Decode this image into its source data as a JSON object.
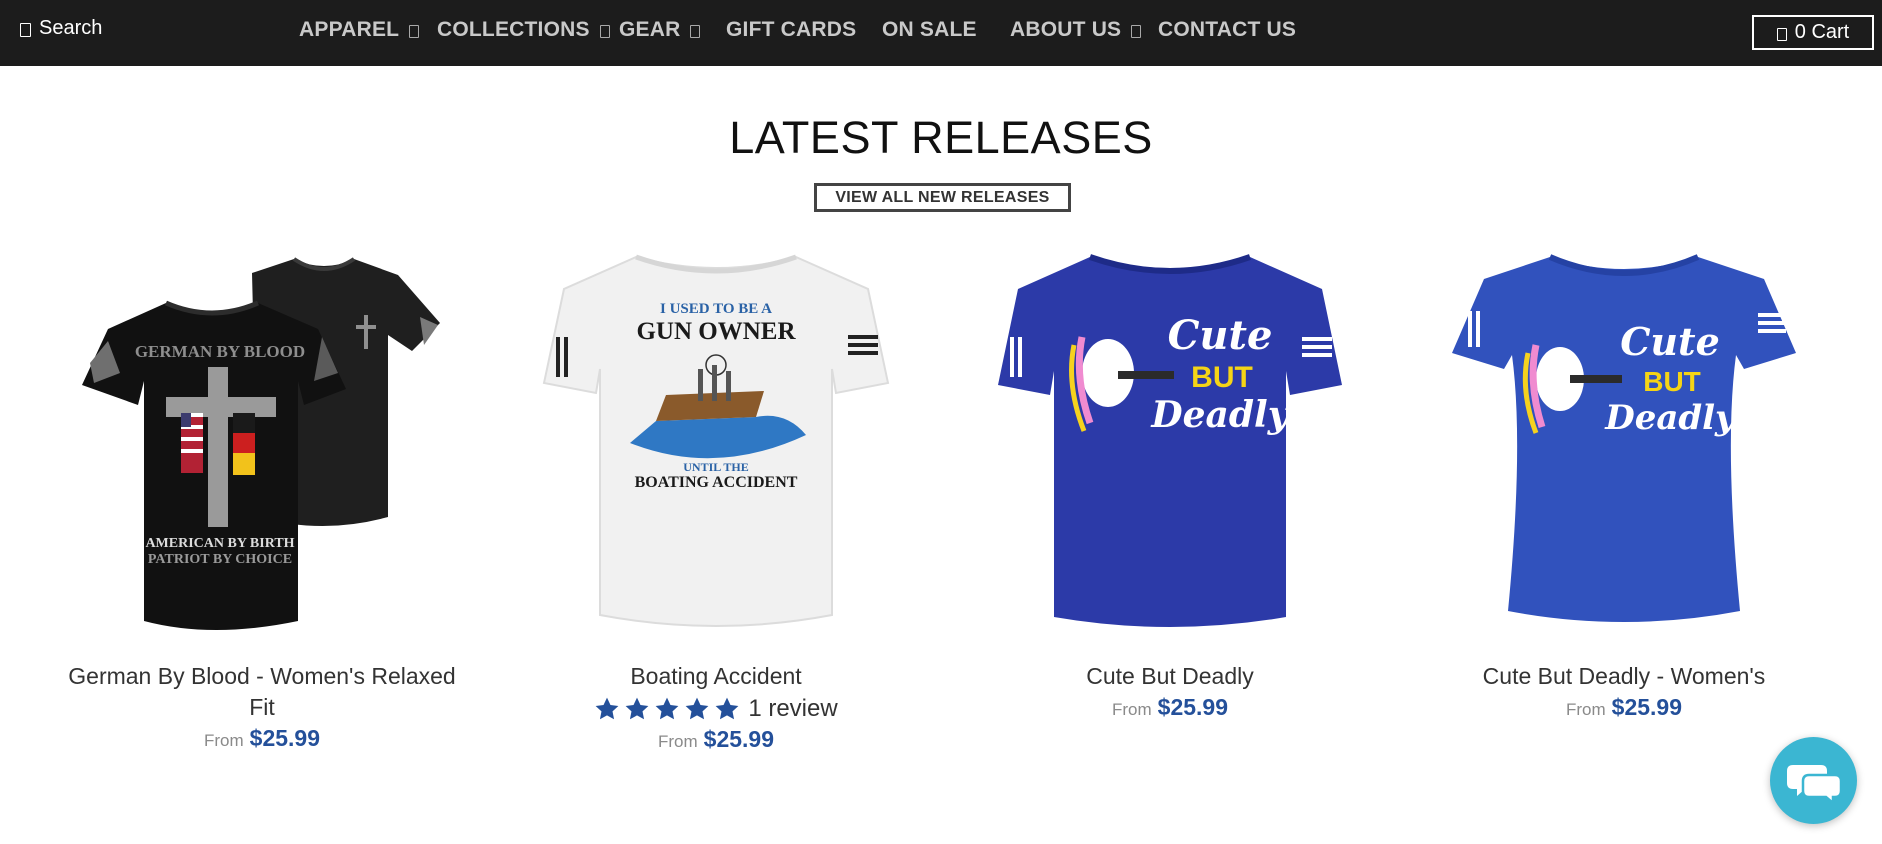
{
  "header": {
    "search_label": "Search",
    "nav": [
      {
        "label": "APPAREL",
        "has_dropdown": true
      },
      {
        "label": "COLLECTIONS",
        "has_dropdown": true
      },
      {
        "label": "GEAR",
        "has_dropdown": true
      },
      {
        "label": "GIFT CARDS",
        "has_dropdown": false
      },
      {
        "label": "ON SALE",
        "has_dropdown": false
      },
      {
        "label": "ABOUT US",
        "has_dropdown": true
      },
      {
        "label": "CONTACT US",
        "has_dropdown": false
      }
    ],
    "cart_label": "0 Cart"
  },
  "section": {
    "title": "LATEST RELEASES",
    "view_all_label": "VIEW ALL NEW RELEASES"
  },
  "products": [
    {
      "title": "German By Blood - Women's Relaxed Fit",
      "price_prefix": "From",
      "price": "$25.99",
      "image_icon": "black-tshirt-cross-flag-print",
      "image_print": [
        "GERMAN BY BLOOD",
        "AMERICAN BY BIRTH",
        "PATRIOT BY CHOICE"
      ]
    },
    {
      "title": "Boating Accident",
      "rating_stars": 5,
      "review_label": "1 review",
      "price_prefix": "From",
      "price": "$25.99",
      "image_icon": "white-tshirt-boat-print",
      "image_print": [
        "I USED TO BE A",
        "GUN OWNER",
        "UNTIL THE",
        "BOATING ACCIDENT"
      ]
    },
    {
      "title": "Cute But Deadly",
      "price_prefix": "From",
      "price": "$25.99",
      "image_icon": "royal-blue-tshirt-unicorn-print",
      "image_print": [
        "Cute",
        "BUT",
        "Deadly"
      ]
    },
    {
      "title": "Cute But Deadly - Women's",
      "price_prefix": "From",
      "price": "$25.99",
      "image_icon": "royal-blue-womens-tshirt-unicorn-print",
      "image_print": [
        "Cute",
        "BUT",
        "Deadly"
      ]
    }
  ],
  "colors": {
    "topbar": "#1c1c1c",
    "nav_text": "#c9c9c9",
    "price": "#24509a",
    "star": "#24509a",
    "chat": "#3bb6d2"
  },
  "chat_icon": "chat-bubbles-icon"
}
